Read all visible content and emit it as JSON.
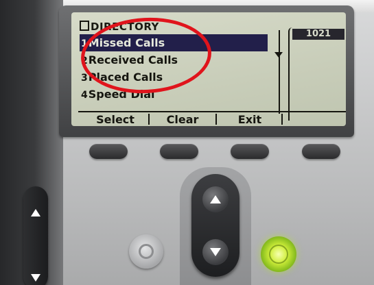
{
  "screen": {
    "title": "DIRECTORY",
    "line_extension": "1021",
    "menu": [
      {
        "num": "1",
        "label": "Missed Calls",
        "selected": true
      },
      {
        "num": "2",
        "label": "Received Calls",
        "selected": false
      },
      {
        "num": "3",
        "label": "Placed Calls",
        "selected": false
      },
      {
        "num": "4",
        "label": "Speed Dial",
        "selected": false
      }
    ],
    "softkeys": [
      "Select",
      "Clear",
      "Exit",
      ""
    ]
  },
  "colors": {
    "lcd_background": "#c8cdb9",
    "highlight": "#221f4a",
    "annotation": "#e0141c",
    "status_led": "#cfee3a"
  },
  "icons": {
    "directory": "book-icon",
    "scroll": "scroll-down-arrow-icon",
    "nav_up": "arrow-up-icon",
    "nav_down": "arrow-down-icon",
    "volume_up": "arrow-up-icon",
    "volume_down": "arrow-down-icon"
  }
}
